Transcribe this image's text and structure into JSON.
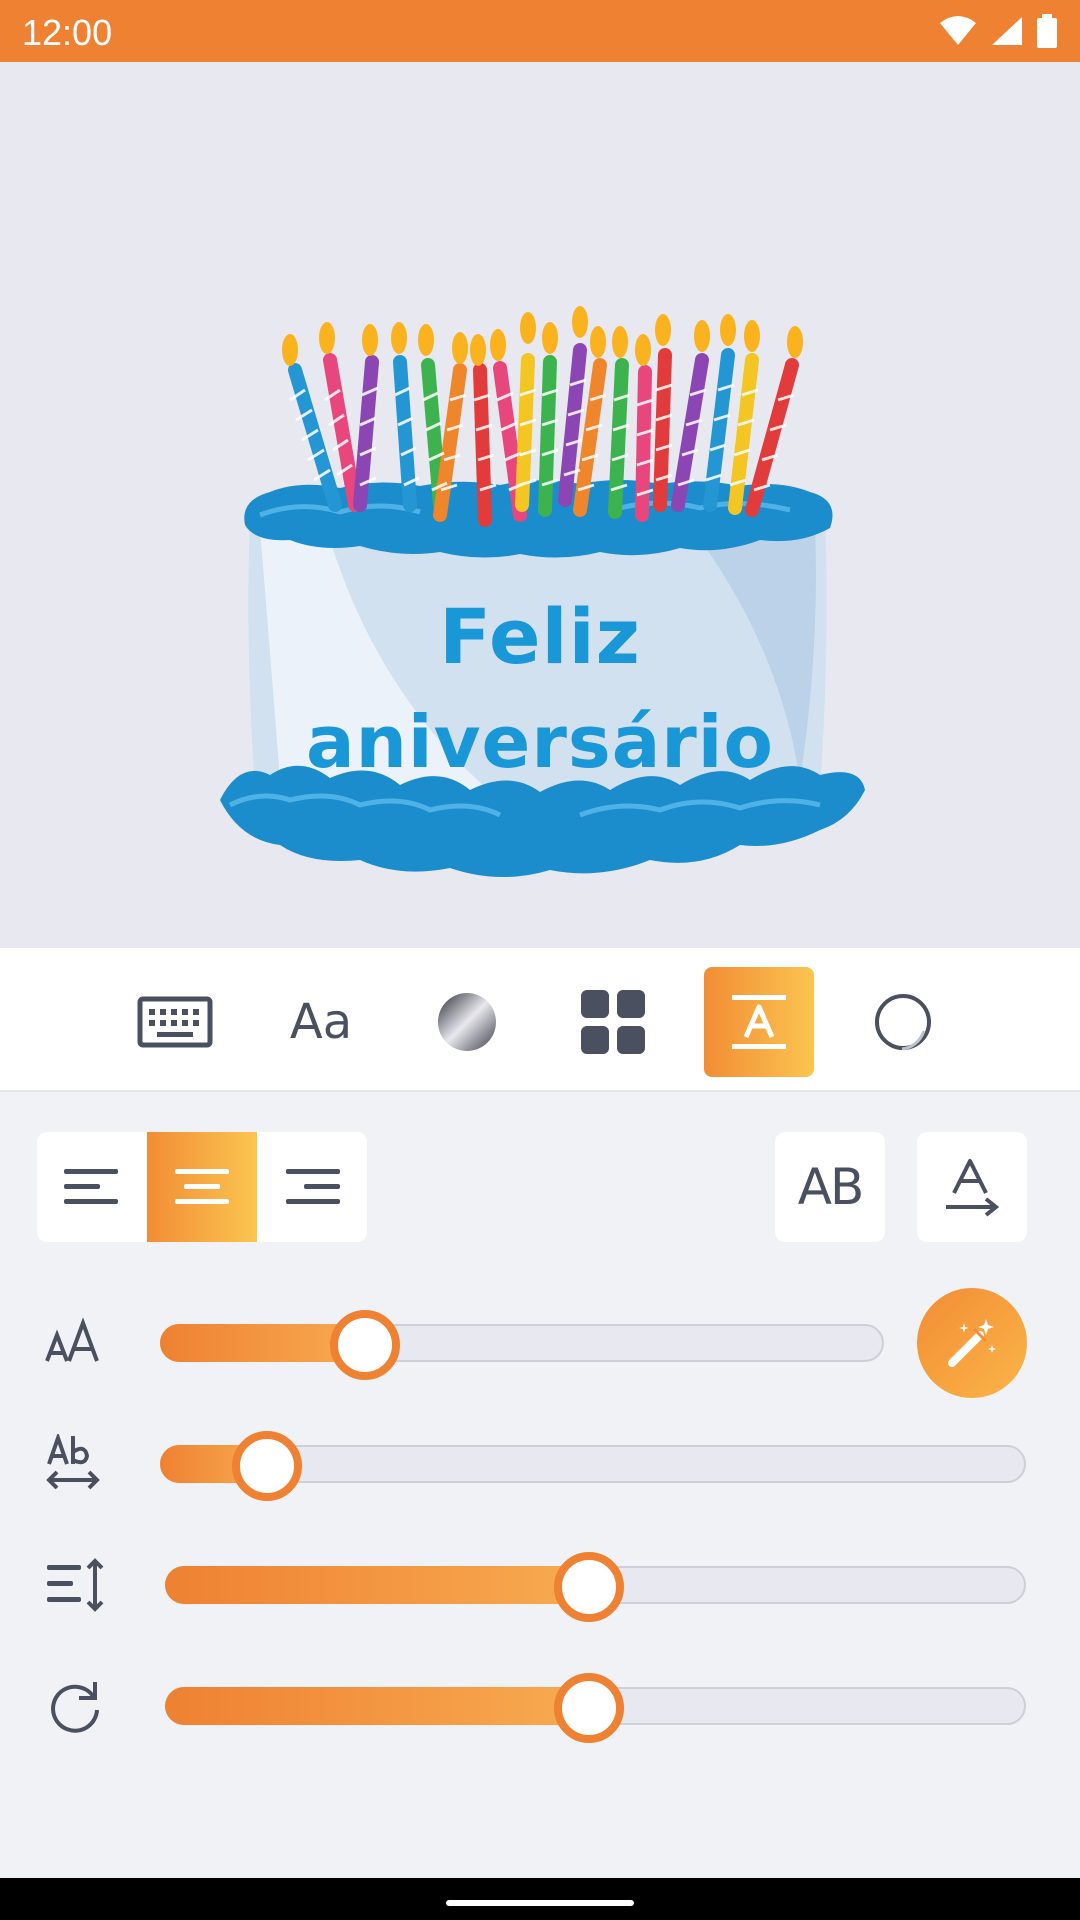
{
  "status_bar": {
    "time": "12:00",
    "icons": [
      "wifi-icon",
      "cellular-signal-icon",
      "battery-icon"
    ]
  },
  "canvas": {
    "text_line_1": "Feliz",
    "text_line_2": "aniversário",
    "text_color": "#1a97d6",
    "image": "birthday-cake-with-candles"
  },
  "toolbar": {
    "tools": [
      {
        "name": "keyboard",
        "icon": "keyboard-icon",
        "label": ""
      },
      {
        "name": "font",
        "icon": "font-icon",
        "label": "Aa"
      },
      {
        "name": "color",
        "icon": "color-gradient-icon",
        "label": ""
      },
      {
        "name": "pattern",
        "icon": "grid-icon",
        "label": ""
      },
      {
        "name": "text-style",
        "icon": "text-underline-icon",
        "label": "",
        "active": true
      },
      {
        "name": "shape",
        "icon": "circle-icon",
        "label": ""
      }
    ]
  },
  "panel": {
    "alignment": {
      "options": [
        "left",
        "center",
        "right"
      ],
      "selected": "center"
    },
    "uppercase_label": "AB",
    "text_path_icon": "text-path-icon",
    "sliders": [
      {
        "name": "font-size",
        "icon": "font-size-icon",
        "value_fraction": 0.28
      },
      {
        "name": "letter-spacing",
        "icon": "letter-spacing-icon",
        "value_fraction": 0.12
      },
      {
        "name": "line-height",
        "icon": "line-height-icon",
        "value_fraction": 0.49
      },
      {
        "name": "rotation",
        "icon": "rotate-icon",
        "value_fraction": 0.49
      }
    ],
    "magic_button_icon": "magic-wand-icon"
  },
  "colors": {
    "accent": "#ee8132",
    "accent_light": "#fbc550",
    "icon_gray": "#4a5060"
  }
}
